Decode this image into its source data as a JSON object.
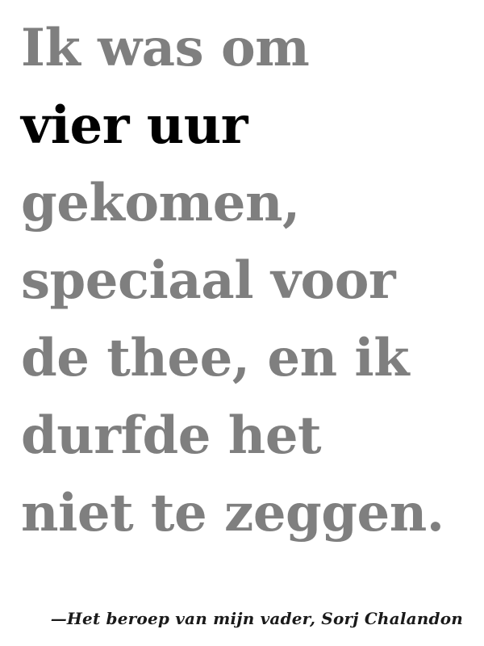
{
  "quote": {
    "lines": [
      {
        "text": "Ik was om",
        "emphasis": false
      },
      {
        "text": "vier uur",
        "emphasis": true
      },
      {
        "text": "gekomen,",
        "emphasis": false
      },
      {
        "text": "speciaal voor",
        "emphasis": false
      },
      {
        "text": "de thee, en ik",
        "emphasis": false
      },
      {
        "text": "durfde het",
        "emphasis": false
      },
      {
        "text": "niet te zeggen.",
        "emphasis": false
      }
    ]
  },
  "attribution": "—Het beroep van mijn vader, Sorj Chalandon",
  "colors": {
    "muted": "#7f7f7f",
    "emphasis": "#000000"
  }
}
